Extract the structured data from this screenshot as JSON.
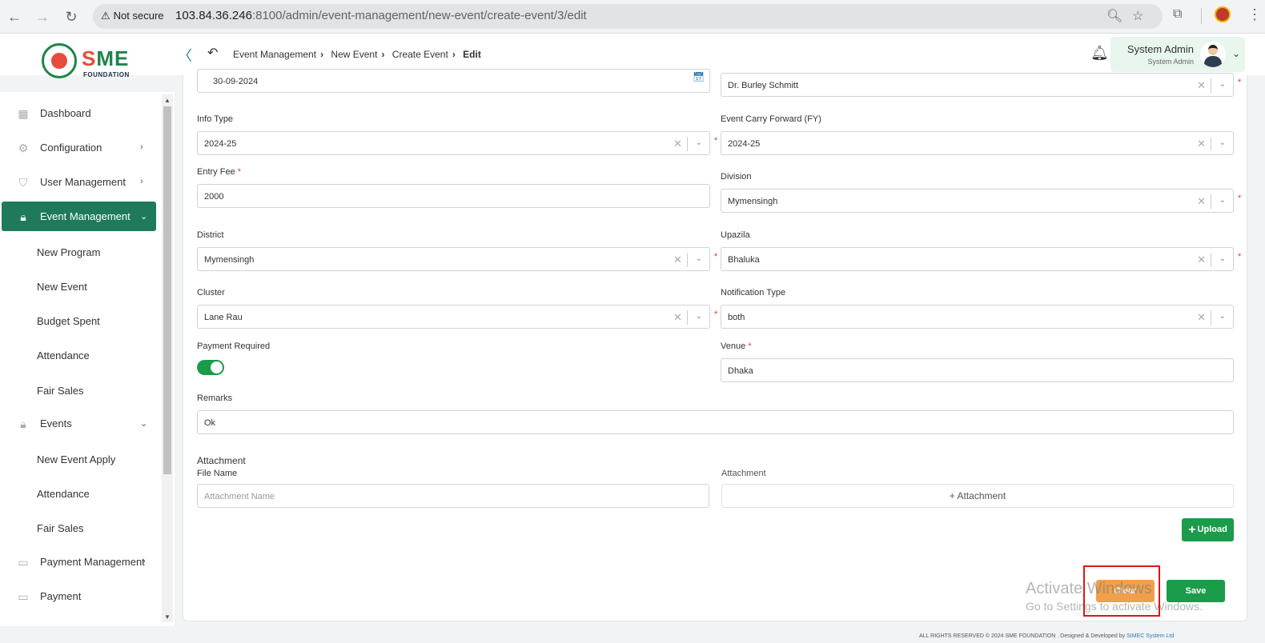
{
  "browser": {
    "security_label": "Not secure",
    "url_host": "103.84.36.246",
    "url_path": ":8100/admin/event-management/new-event/create-event/3/edit"
  },
  "logo": {
    "brand": "SME",
    "brand_first": "S",
    "brand_rest": "ME",
    "subtitle": "FOUNDATION"
  },
  "header": {
    "breadcrumb": [
      "Event Management",
      "New Event",
      "Create Event",
      "Edit"
    ],
    "user_name": "System Admin",
    "user_role": "System Admin"
  },
  "sidebar": {
    "items": [
      {
        "label": "Dashboard"
      },
      {
        "label": "Configuration"
      },
      {
        "label": "User Management"
      },
      {
        "label": "Event Management"
      },
      {
        "label": "New Program"
      },
      {
        "label": "New Event"
      },
      {
        "label": "Budget Spent"
      },
      {
        "label": "Attendance"
      },
      {
        "label": "Fair Sales"
      },
      {
        "label": "Events"
      },
      {
        "label": "New Event Apply"
      },
      {
        "label": "Attendance"
      },
      {
        "label": "Fair Sales"
      },
      {
        "label": "Payment Management"
      },
      {
        "label": "Payment"
      }
    ]
  },
  "form": {
    "date_value": "30-09-2024",
    "top_right_value": "Dr. Burley Schmitt",
    "info_type": {
      "label": "Info Type",
      "value": "2024-25"
    },
    "carry_forward": {
      "label": "Event Carry Forward (FY)",
      "value": "2024-25"
    },
    "entry_fee": {
      "label": "Entry Fee",
      "value": "2000"
    },
    "division": {
      "label": "Division",
      "value": "Mymensingh"
    },
    "district": {
      "label": "District",
      "value": "Mymensingh"
    },
    "upazila": {
      "label": "Upazila",
      "value": "Bhaluka"
    },
    "cluster": {
      "label": "Cluster",
      "value": "Lane Rau"
    },
    "notification_type": {
      "label": "Notification Type",
      "value": "both"
    },
    "payment_required": {
      "label": "Payment Required",
      "value": true
    },
    "venue": {
      "label": "Venue",
      "value": "Dhaka"
    },
    "remarks": {
      "label": "Remarks",
      "value": "Ok"
    },
    "required_mark": "*",
    "attachment": {
      "title": "Attachment",
      "file_name_label": "File Name",
      "file_name_placeholder": "Attachment Name",
      "attachment_label": "Attachment",
      "attachment_button": "+ Attachment",
      "upload_button": "Upload"
    },
    "clear_button": "Clear",
    "save_button": "Save"
  },
  "watermark": {
    "line1": "Activate Windows",
    "line2": "Go to Settings to activate Windows."
  },
  "footer": {
    "text": "ALL RIGHTS RESERVED © 2024 SME FOUNDATION . Designed & Developed by ",
    "link": "SIMEC System Ltd"
  },
  "colors": {
    "primary": "#1f7a5c",
    "success": "#1a9c4a",
    "warning": "#f0a04b",
    "danger": "#e53935"
  }
}
